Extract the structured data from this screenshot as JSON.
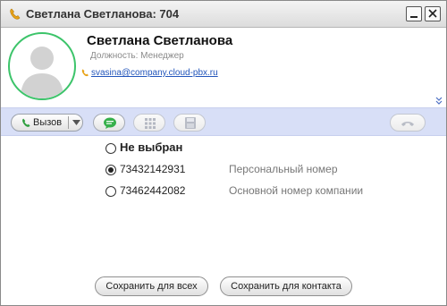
{
  "window": {
    "title": "Светлана Светланова: 704",
    "icons": {
      "title": "phone-handset-icon",
      "minimize": "minimize-icon",
      "close": "close-icon"
    }
  },
  "contact": {
    "name": "Светлана Светланова",
    "role": "Должность: Менеджер",
    "email": "svasina@company.cloud-pbx.ru",
    "avatar_icon": "person-silhouette-icon",
    "avatar_ring_color": "#3cc46a"
  },
  "toolbar": {
    "call_label": "Вызов",
    "icons": [
      "phone-icon",
      "chevron-down-icon",
      "chat-bubble-icon",
      "dialpad-icon",
      "save-disk-icon",
      "hangup-icon"
    ],
    "background": "#d8dff7"
  },
  "options": [
    {
      "label": "Не выбран",
      "description": "",
      "checked": false
    },
    {
      "label": "73432142931",
      "description": "Персональный номер",
      "checked": true
    },
    {
      "label": "73462442082",
      "description": "Основной номер компании",
      "checked": false
    }
  ],
  "actions": {
    "save_all": "Сохранить для всех",
    "save_contact": "Сохранить для контакта"
  }
}
